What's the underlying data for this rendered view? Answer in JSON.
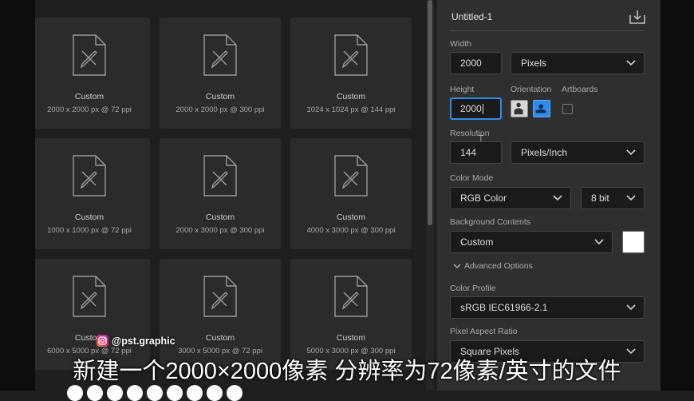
{
  "presets": [
    {
      "name": "Custom",
      "spec": "2000 x 2000 px @ 72 ppi"
    },
    {
      "name": "Custom",
      "spec": "2000 x 2000 px @ 300 ppi"
    },
    {
      "name": "Custom",
      "spec": "1024 x 1024 px @ 144 ppi"
    },
    {
      "name": "Custom",
      "spec": "1000 x 1000 px @ 72 ppi"
    },
    {
      "name": "Custom",
      "spec": "2000 x 3000 px @ 300 ppi"
    },
    {
      "name": "Custom",
      "spec": "4000 x 3000 px @ 300 ppi"
    },
    {
      "name": "Custom",
      "spec": "6000 x 5000 px @ 72 ppi"
    },
    {
      "name": "Custom",
      "spec": "3000 x 5000 px @ 72 ppi"
    },
    {
      "name": "Custom",
      "spec": "5000 x 3000 px @ 300 ppi"
    }
  ],
  "details": {
    "doc_name": "Untitled-1",
    "width_label": "Width",
    "width_value": "2000",
    "width_unit": "Pixels",
    "height_label": "Height",
    "height_value": "2000",
    "orientation_label": "Orientation",
    "artboards_label": "Artboards",
    "resolution_label": "Resolution",
    "resolution_value": "144",
    "resolution_unit": "Pixels/Inch",
    "color_mode_label": "Color Mode",
    "color_mode": "RGB Color",
    "bit_depth": "8 bit",
    "background_label": "Background Contents",
    "background_value": "Custom",
    "advanced_label": "Advanced Options",
    "color_profile_label": "Color Profile",
    "color_profile": "sRGB IEC61966-2.1",
    "pixel_aspect_label": "Pixel Aspect Ratio",
    "pixel_aspect": "Square Pixels"
  },
  "overlay": {
    "watermark": "@pst.graphic",
    "subtitle": "新建一个2000×2000像素 分辨率为72像素/英寸的文件"
  },
  "colors": {
    "accent": "#2d8ceb",
    "background_swatch": "#ffffff"
  }
}
